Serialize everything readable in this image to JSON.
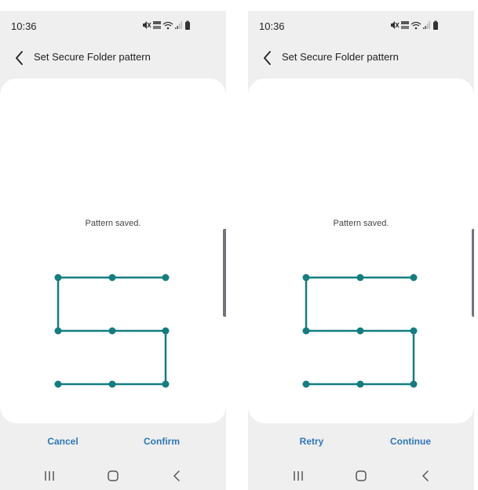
{
  "colors": {
    "accent": "#2f76b8",
    "pattern": "#137d80",
    "background": "#efefef",
    "card": "#ffffff"
  },
  "screens": [
    {
      "status_time": "10:36",
      "title": "Set Secure Folder pattern",
      "status_text": "Pattern saved.",
      "pattern_sequence": [
        3,
        2,
        1,
        4,
        5,
        6,
        9,
        8,
        7
      ],
      "left_button": "Cancel",
      "right_button": "Confirm"
    },
    {
      "status_time": "10:36",
      "title": "Set Secure Folder pattern",
      "status_text": "Pattern saved.",
      "pattern_sequence": [
        3,
        2,
        1,
        4,
        5,
        6,
        9,
        8,
        7
      ],
      "left_button": "Retry",
      "right_button": "Continue"
    }
  ],
  "icons": {
    "status": [
      "mute-icon",
      "volte-icon",
      "wifi-icon",
      "signal-icon",
      "battery-icon"
    ],
    "nav": [
      "recents-icon",
      "home-icon",
      "back-nav-icon"
    ]
  }
}
